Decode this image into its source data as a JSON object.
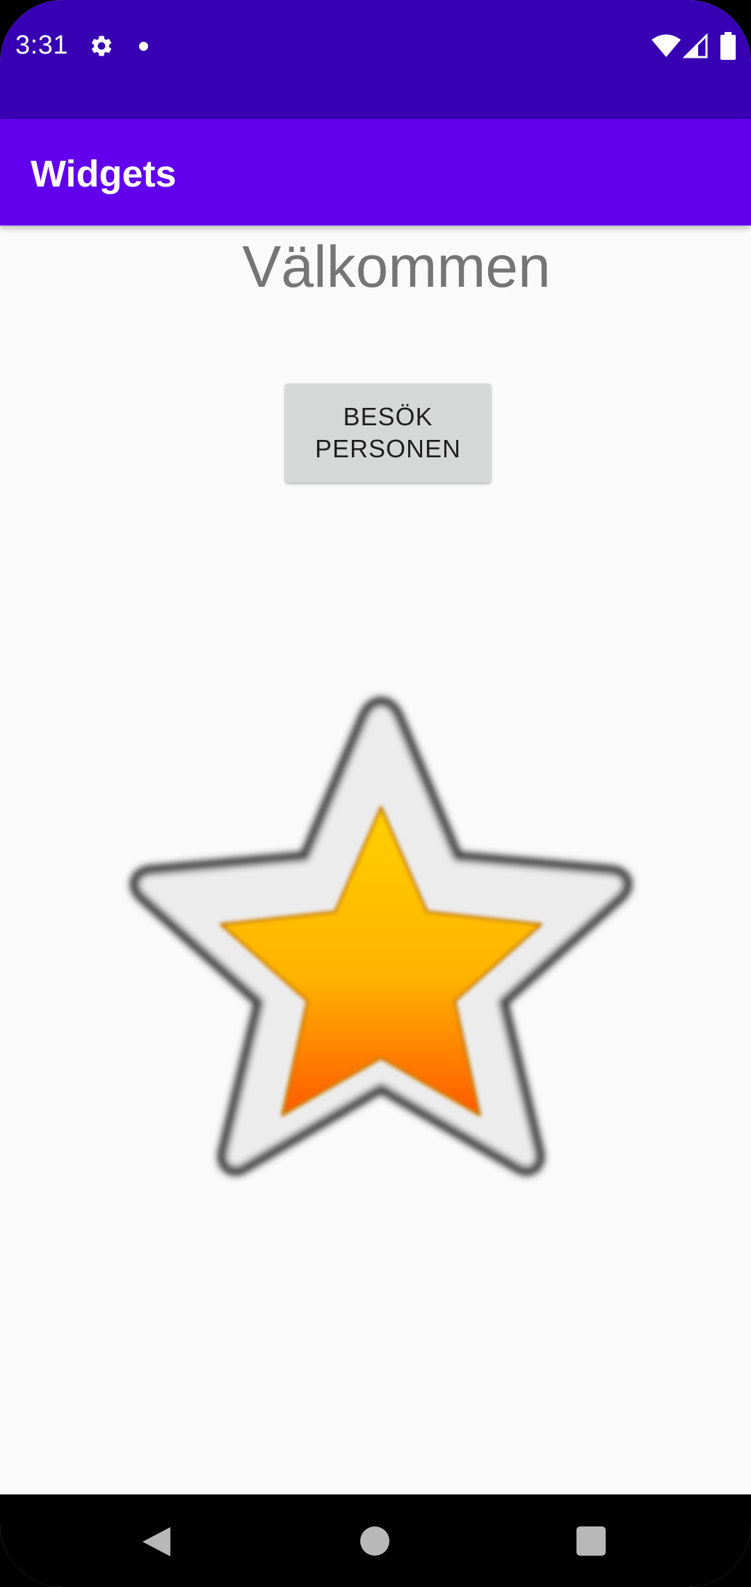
{
  "status_bar": {
    "time": "3:31",
    "icons": [
      "gear-icon",
      "notification-dot-icon",
      "wifi-icon",
      "signal-icon",
      "battery-icon"
    ],
    "background": "#3700b3"
  },
  "app_bar": {
    "title": "Widgets",
    "background": "#6200ee"
  },
  "main": {
    "heading": "Välkommen",
    "button_label": "BESÖK PERSONEN",
    "image_icon": "star-icon"
  },
  "nav_bar": {
    "icons": [
      "back-icon",
      "home-icon",
      "recents-icon"
    ]
  },
  "colors": {
    "background": "#fafafa",
    "heading": "#757575",
    "button": "#d6d7d7",
    "star_fill_top": "#ffd000",
    "star_fill_bottom": "#ff5a00"
  }
}
